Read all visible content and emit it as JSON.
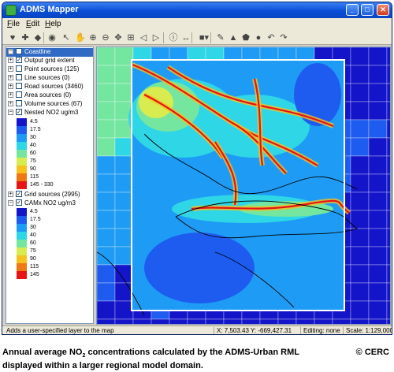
{
  "window": {
    "title": "ADMS Mapper"
  },
  "menu": [
    "File",
    "Edit",
    "Help"
  ],
  "toolbar_icons": [
    "layer-red-icon",
    "layer-red2-icon",
    "layer-blue-icon",
    "globe-icon",
    "pointer-icon",
    "hand-icon",
    "zoom-in-icon",
    "zoom-out-icon",
    "pan-icon",
    "zoom-extent-icon",
    "back-icon",
    "forward-icon",
    "info-icon",
    "measure-icon",
    "fill-dropdown-icon",
    "draw-icon",
    "shape-icon",
    "polygon-icon",
    "node-icon",
    "undo-icon",
    "redo-icon"
  ],
  "layers": {
    "items": [
      {
        "label": "Coastline",
        "checked": true,
        "expander": "−",
        "selected": true
      },
      {
        "label": "Output grid extent",
        "checked": true,
        "expander": "+"
      },
      {
        "label": "Point sources (125)",
        "checked": false,
        "expander": "+"
      },
      {
        "label": "Line sources (0)",
        "checked": false,
        "expander": "+"
      },
      {
        "label": "Road sources (3460)",
        "checked": false,
        "expander": "+"
      },
      {
        "label": "Area sources (0)",
        "checked": false,
        "expander": "+"
      },
      {
        "label": "Volume sources (67)",
        "checked": false,
        "expander": "+"
      },
      {
        "label": "Nested NO2 ug/m3",
        "checked": true,
        "expander": "−"
      }
    ],
    "nested_legend": [
      {
        "label": "4.5",
        "color": "#1414c8"
      },
      {
        "label": "17.5",
        "color": "#1e5cf0"
      },
      {
        "label": "30",
        "color": "#1e9cf5"
      },
      {
        "label": "40",
        "color": "#2ed6e6"
      },
      {
        "label": "60",
        "color": "#74e6a0"
      },
      {
        "label": "75",
        "color": "#d8ec50"
      },
      {
        "label": "90",
        "color": "#f5c21e"
      },
      {
        "label": "115",
        "color": "#f07814"
      },
      {
        "label": "145 - 330",
        "color": "#e61414"
      }
    ],
    "grid_sources": {
      "label": "Grid sources (2995)",
      "checked": true,
      "expander": "+"
    },
    "camx": {
      "label": "CAMx NO2 ug/m3",
      "checked": true,
      "expander": "−"
    },
    "camx_legend": [
      {
        "label": "4.5",
        "color": "#1414c8"
      },
      {
        "label": "17.5",
        "color": "#1e5cf0"
      },
      {
        "label": "30",
        "color": "#1e9cf5"
      },
      {
        "label": "40",
        "color": "#2ed6e6"
      },
      {
        "label": "60",
        "color": "#74e6a0"
      },
      {
        "label": "75",
        "color": "#d8ec50"
      },
      {
        "label": "90",
        "color": "#f5c21e"
      },
      {
        "label": "115",
        "color": "#f07814"
      },
      {
        "label": "145",
        "color": "#e61414"
      }
    ]
  },
  "status": {
    "hint": "Adds a user-specified layer to the map",
    "coords": "X: 7,503.43  Y: -669,427.31",
    "editing": "Editing: none",
    "scale": "Scale: 1:129,000"
  },
  "caption": {
    "line1_a": "Annual average NO",
    "line1_sub": "2",
    "line1_b": " concentrations calculated by the ADMS-Urban RML",
    "line2": "displayed within a larger regional model domain.",
    "copyright": "© CERC"
  },
  "colors": {
    "titlebar": "#0a4fd6",
    "panel_selected": "#316ac5"
  }
}
